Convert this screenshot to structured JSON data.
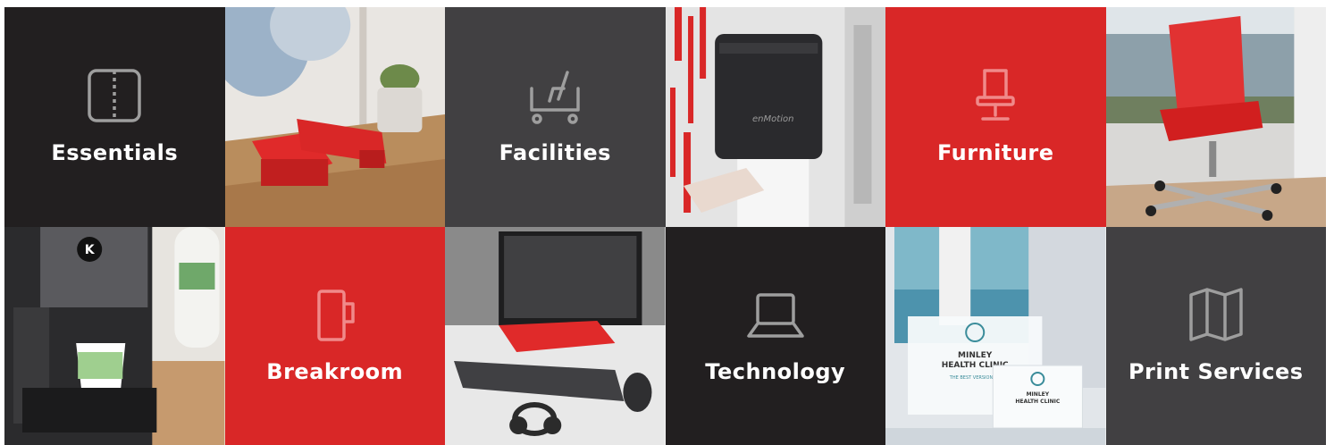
{
  "tiles": [
    {
      "label": "Essentials",
      "icon": "binder-icon",
      "style": "dark"
    },
    {
      "photo": "desk-accessories-photo"
    },
    {
      "label": "Facilities",
      "icon": "cart-icon",
      "style": "gray"
    },
    {
      "photo": "towel-dispenser-photo"
    },
    {
      "label": "Furniture",
      "icon": "chair-icon",
      "style": "red"
    },
    {
      "photo": "office-chair-photo"
    },
    {
      "photo": "coffee-maker-photo"
    },
    {
      "label": "Breakroom",
      "icon": "mug-icon",
      "style": "red"
    },
    {
      "photo": "workstation-photo"
    },
    {
      "label": "Technology",
      "icon": "laptop-icon",
      "style": "dark"
    },
    {
      "photo": "brochure-holder-photo",
      "text": [
        "MINLEY",
        "HEALTH CLINIC",
        "THE BEST VERSION OF"
      ]
    },
    {
      "label": "Print Services",
      "icon": "map-icon",
      "style": "gray"
    }
  ],
  "colors": {
    "dark": "#221f20",
    "gray": "#414042",
    "red": "#d92727",
    "icon_gray": "#9e9e9e",
    "icon_red": "#f08a8a"
  }
}
